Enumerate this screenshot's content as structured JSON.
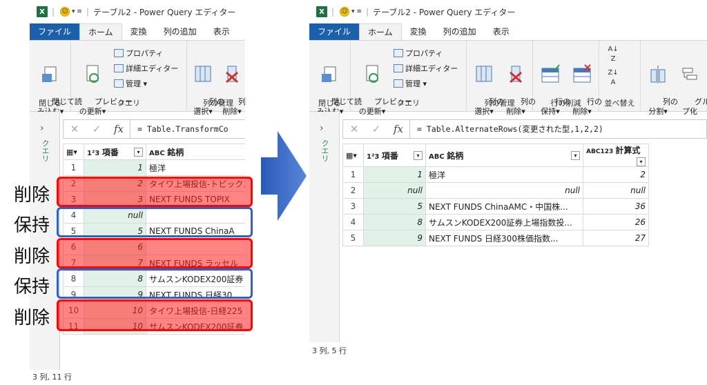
{
  "left": {
    "title": "テーブル2 - Power Query エディター",
    "tabs": [
      "ファイル",
      "ホーム",
      "変換",
      "列の追加",
      "表示"
    ],
    "ribbon": {
      "close_load": "閉じて読\nみ込む▾",
      "group_close": "閉じる",
      "preview": "プレビュー\nの更新▾",
      "properties": "プロパティ",
      "advanced_editor": "詳細エディター",
      "manage": "管理 ▾",
      "group_query": "クエリ",
      "select_cols": "列の\n選択▾",
      "remove_cols": "列の\n削除▾",
      "group_manage_cols": "列の管理"
    },
    "queries_label": "クエリ",
    "formula": "= Table.TransformCo",
    "headers": [
      "項番",
      "銘柄"
    ],
    "rows": [
      {
        "n": "1",
        "num": "1",
        "name": "極洋"
      },
      {
        "n": "2",
        "num": "2",
        "name": "タイワ上場投信-トピックス"
      },
      {
        "n": "3",
        "num": "3",
        "name": "NEXT FUNDS TOPIX"
      },
      {
        "n": "4",
        "num": "null",
        "name": ""
      },
      {
        "n": "5",
        "num": "5",
        "name": "NEXT FUNDS ChinaA"
      },
      {
        "n": "6",
        "num": "6",
        "name": ""
      },
      {
        "n": "7",
        "num": "7",
        "name": "NEXT FUNDS ラッセル"
      },
      {
        "n": "8",
        "num": "8",
        "name": "サムスンKODEX200証券"
      },
      {
        "n": "9",
        "num": "9",
        "name": "NEXT FUNDS 日経30"
      },
      {
        "n": "10",
        "num": "10",
        "name": "タイワ上場投信-日経225"
      },
      {
        "n": "11",
        "num": "10",
        "name": "サムスンKODEX200証券"
      }
    ],
    "status": "3 列, 11 行"
  },
  "labels": {
    "remove": "削除",
    "keep": "保持"
  },
  "right": {
    "title": "テーブル2 - Power Query エディター",
    "tabs": [
      "ファイル",
      "ホーム",
      "変換",
      "列の追加",
      "表示"
    ],
    "ribbon": {
      "close_load": "閉じて読\nみ込む▾",
      "group_close": "閉じる",
      "preview": "プレビュー\nの更新▾",
      "properties": "プロパティ",
      "advanced_editor": "詳細エディター",
      "manage": "管理 ▾",
      "group_query": "クエリ",
      "select_cols": "列の\n選択▾",
      "remove_cols": "列の\n削除▾",
      "group_manage_cols": "列の管理",
      "keep_rows": "行の\n保持▾",
      "remove_rows": "行の\n削除▾",
      "group_reduce_rows": "行の削減",
      "group_sort": "並べ替え",
      "split_col": "列の\n分割▾",
      "group_by": "グルー\nプ化"
    },
    "queries_label": "クエリ",
    "formula": "= Table.AlternateRows(変更された型,1,2,2)",
    "headers": [
      "項番",
      "銘柄",
      "計算式"
    ],
    "rows": [
      {
        "n": "1",
        "num": "1",
        "name": "極洋",
        "calc": "2"
      },
      {
        "n": "2",
        "num": "null",
        "name": "null",
        "calc": "null"
      },
      {
        "n": "3",
        "num": "5",
        "name": "NEXT FUNDS ChinaAMC・中国株...",
        "calc": "36"
      },
      {
        "n": "4",
        "num": "8",
        "name": "サムスンKODEX200証券上場指数投...",
        "calc": "26"
      },
      {
        "n": "5",
        "num": "9",
        "name": "NEXT FUNDS 日経300株価指数...",
        "calc": "27"
      }
    ],
    "status": "3 列, 5 行"
  },
  "colors": {
    "remove": "#ff0000",
    "keep": "#3060c0",
    "arrow": "#3a6bc6",
    "green": "#e2f2e8",
    "file_tab": "#1c5faa"
  }
}
